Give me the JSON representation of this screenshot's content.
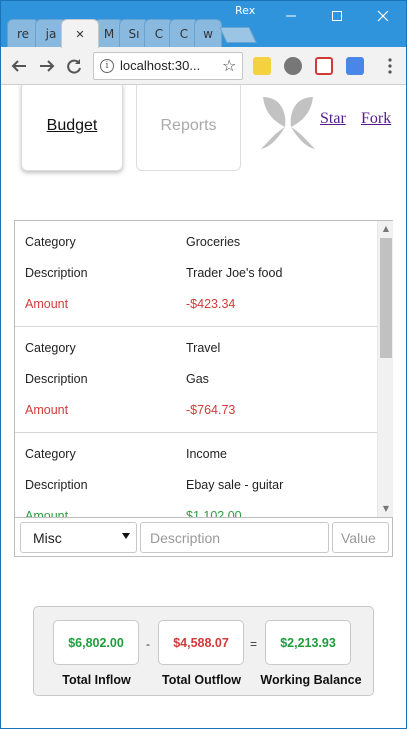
{
  "window": {
    "profile_name": "Rex",
    "tabs": [
      {
        "label": "re"
      },
      {
        "label": "ja"
      },
      {
        "label": "✕"
      },
      {
        "label": "M"
      },
      {
        "label": "Sı"
      },
      {
        "label": "C"
      },
      {
        "label": "C"
      },
      {
        "label": "w"
      }
    ]
  },
  "toolbar": {
    "url": "localhost:30..."
  },
  "nav": {
    "budget": "Budget",
    "reports": "Reports",
    "star": "Star",
    "fork": "Fork"
  },
  "transactions": [
    {
      "category_label": "Category",
      "category": "Groceries",
      "description_label": "Description",
      "description": "Trader Joe's food",
      "amount_label": "Amount",
      "amount": "-$423.34",
      "sign": "neg"
    },
    {
      "category_label": "Category",
      "category": "Travel",
      "description_label": "Description",
      "description": "Gas",
      "amount_label": "Amount",
      "amount": "-$764.73",
      "sign": "neg"
    },
    {
      "category_label": "Category",
      "category": "Income",
      "description_label": "Description",
      "description": "Ebay sale - guitar",
      "amount_label": "Amount",
      "amount": "$1,102.00",
      "sign": "pos"
    }
  ],
  "entry": {
    "category_selected": "Misc",
    "description_placeholder": "Description",
    "value_placeholder": "Value"
  },
  "totals": {
    "inflow": "$6,802.00",
    "outflow": "$4,588.07",
    "balance": "$2,213.93",
    "minus": "-",
    "equals": "=",
    "inflow_label": "Total Inflow",
    "outflow_label": "Total Outflow",
    "balance_label": "Working Balance"
  },
  "colors": {
    "positive": "#1f9d3a",
    "negative": "#d23a3a",
    "chrome_blue": "#2f94dc"
  }
}
